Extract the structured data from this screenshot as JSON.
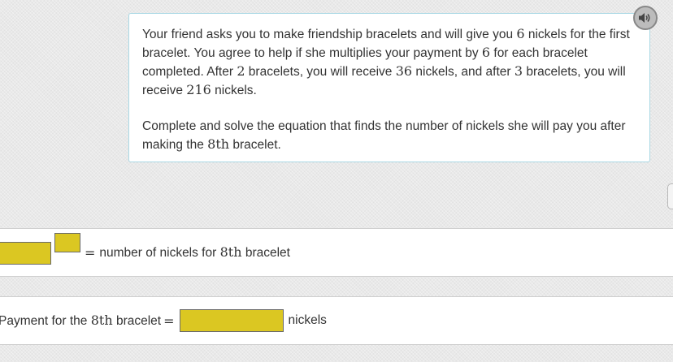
{
  "problem": {
    "p1": [
      "Your friend asks you to make friendship bracelets and will give you ",
      "6",
      " nickels for the first bracelet. You agree to help if she multiplies your payment by ",
      "6",
      " for each bracelet completed. After ",
      "2",
      " bracelets, you will receive ",
      "36",
      " nickels, and after ",
      "3",
      " bracelets, you will receive ",
      "216",
      " nickels."
    ],
    "p2": [
      "Complete and solve the equation that finds the number of nickels she will pay you after making the ",
      "8th",
      " bracelet."
    ]
  },
  "audio_button": {
    "icon": "speaker-icon"
  },
  "equation1": {
    "equals": "=",
    "text_before": "number of nickels for ",
    "math": "8th",
    "text_after": " bracelet",
    "blank_color": "#dbc722"
  },
  "equation2": {
    "text_before": "Payment for the ",
    "math": "8th",
    "text_after": " bracelet",
    "equals": "=",
    "unit": "nickels",
    "blank_color": "#dbc722"
  }
}
